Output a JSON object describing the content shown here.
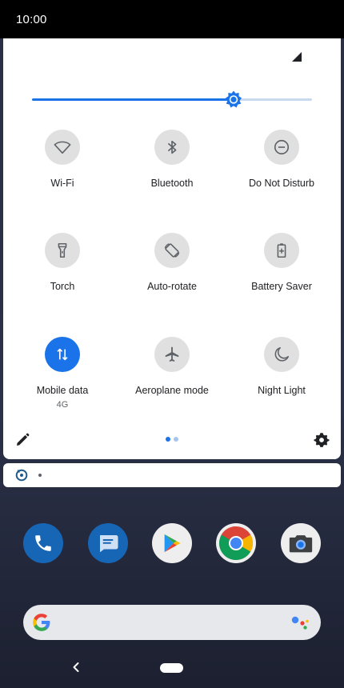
{
  "status_bar": {
    "time": "10:00"
  },
  "brightness": {
    "level_fraction": 0.72
  },
  "tiles": [
    {
      "label": "Wi-Fi",
      "sub": "",
      "icon": "wifi-icon",
      "active": false
    },
    {
      "label": "Bluetooth",
      "sub": "",
      "icon": "bluetooth-icon",
      "active": false
    },
    {
      "label": "Do Not Disturb",
      "sub": "",
      "icon": "do-not-disturb-icon",
      "active": false
    },
    {
      "label": "Torch",
      "sub": "",
      "icon": "torch-icon",
      "active": false
    },
    {
      "label": "Auto-rotate",
      "sub": "",
      "icon": "auto-rotate-icon",
      "active": false
    },
    {
      "label": "Battery Saver",
      "sub": "",
      "icon": "battery-saver-icon",
      "active": false
    },
    {
      "label": "Mobile data",
      "sub": "4G",
      "icon": "mobile-data-icon",
      "active": true
    },
    {
      "label": "Aeroplane mode",
      "sub": "",
      "icon": "aeroplane-icon",
      "active": false
    },
    {
      "label": "Night Light",
      "sub": "",
      "icon": "night-light-icon",
      "active": false
    }
  ],
  "pager": {
    "pages": 2,
    "current": 1
  },
  "colors": {
    "accent": "#1a73e8",
    "tile_off": "#e0e0e0",
    "icon_off": "#5f6368"
  }
}
